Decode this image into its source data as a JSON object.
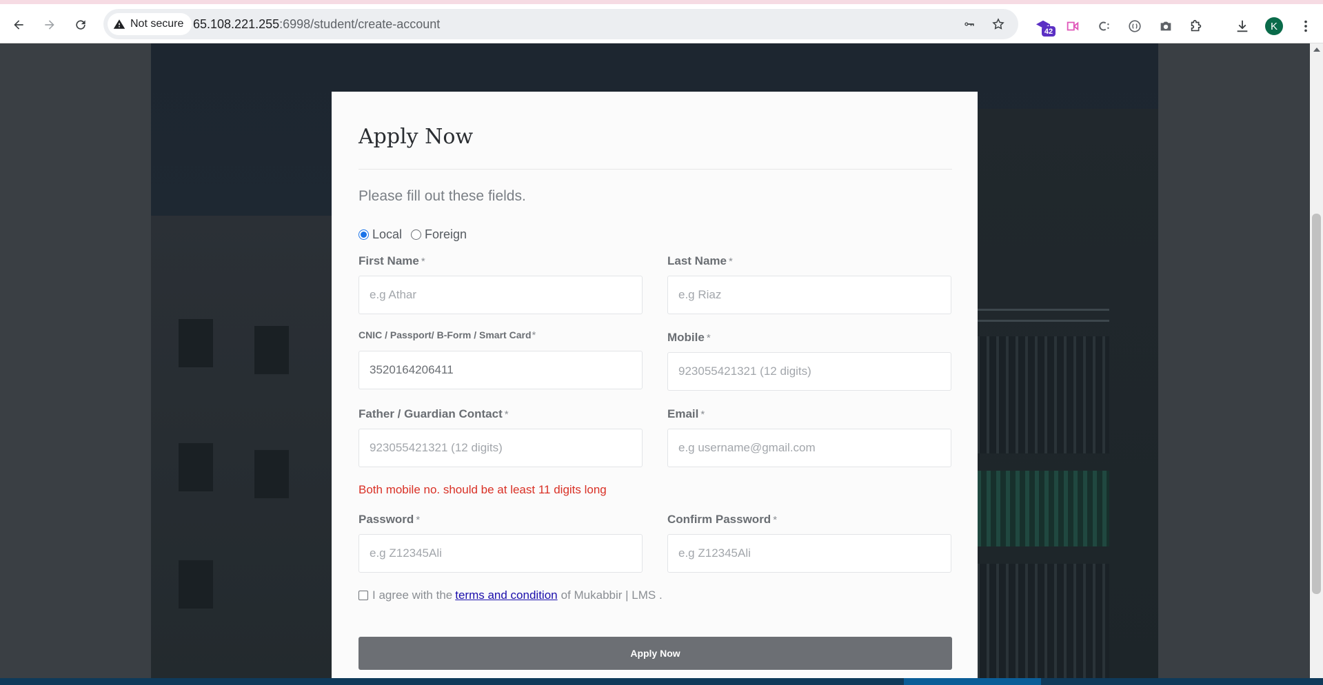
{
  "browser": {
    "security_label": "Not secure",
    "url_host": "65.108.221.255",
    "url_path": ":6998/student/create-account",
    "extension_badge": "42",
    "profile_initial": "K"
  },
  "form": {
    "title": "Apply Now",
    "subtitle": "Please fill out these fields.",
    "residency": {
      "options": [
        "Local",
        "Foreign"
      ],
      "selected": "Local"
    },
    "first_name": {
      "label": "First Name",
      "required_mark": "*",
      "placeholder": "e.g Athar"
    },
    "last_name": {
      "label": "Last Name",
      "required_mark": "*",
      "placeholder": "e.g Riaz"
    },
    "cnic": {
      "label": "CNIC / Passport/ B-Form / Smart Card",
      "required_mark": "*",
      "value": "3520164206411"
    },
    "mobile": {
      "label": "Mobile",
      "required_mark": "*",
      "placeholder": "923055421321 (12 digits)"
    },
    "guardian_contact": {
      "label": "Father / Guardian Contact",
      "required_mark": "*",
      "placeholder": "923055421321 (12 digits)"
    },
    "email": {
      "label": "Email",
      "required_mark": "*",
      "placeholder": "e.g username@gmail.com"
    },
    "error_message": "Both mobile no. should be at least 11 digits long",
    "password": {
      "label": "Password",
      "required_mark": "*",
      "placeholder": "e.g Z12345Ali"
    },
    "confirm_password": {
      "label": "Confirm Password",
      "required_mark": "*",
      "placeholder": "e.g Z12345Ali"
    },
    "terms": {
      "prefix": "I agree with the",
      "link_text": "terms and condition",
      "suffix": "of Mukabbir | LMS ."
    },
    "submit_label": "Apply Now"
  },
  "colors": {
    "error": "#d93025",
    "link": "#1a0dab",
    "button": "#6c6f74",
    "radio_accent": "#1a73e8"
  }
}
